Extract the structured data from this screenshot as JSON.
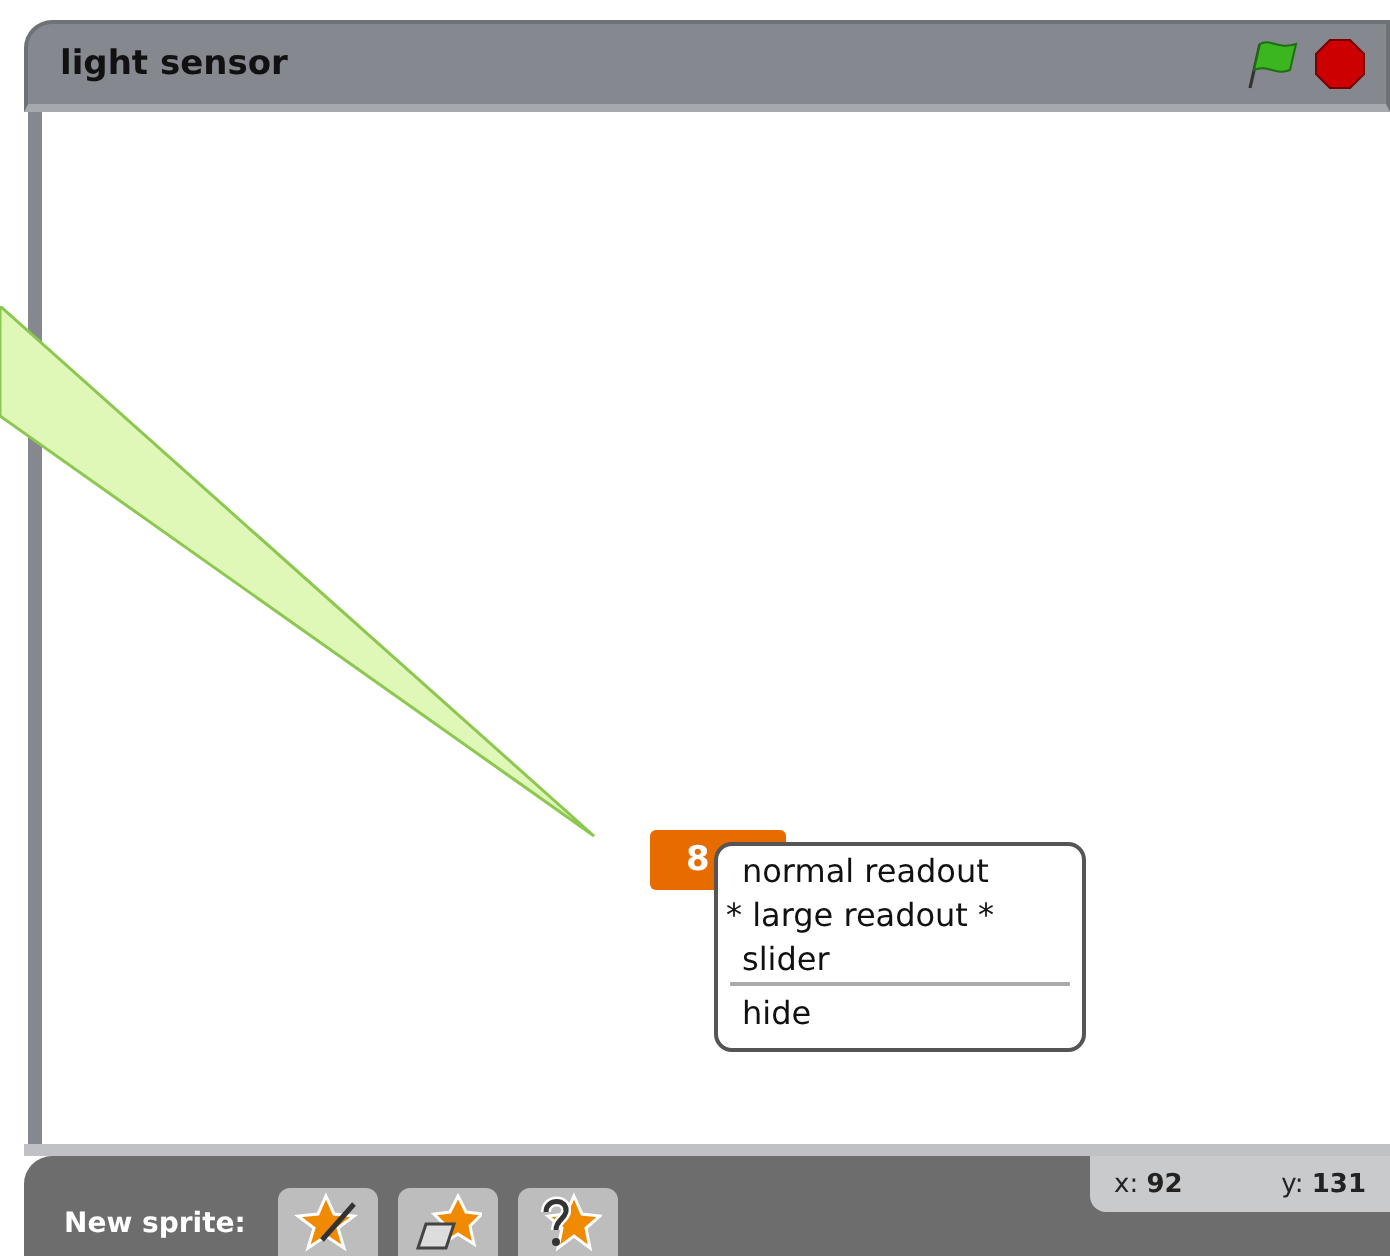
{
  "stage": {
    "title": "light sensor"
  },
  "readout": {
    "value": "8"
  },
  "context_menu": {
    "items": [
      {
        "label": "normal readout",
        "divider_after": false
      },
      {
        "label": "* large readout *",
        "divider_after": false
      },
      {
        "label": "slider",
        "divider_after": true
      },
      {
        "label": "hide",
        "divider_after": false
      }
    ]
  },
  "coordinates": {
    "x": "x: **92**",
    "y": "y: **131**"
  },
  "sprite_bar": {
    "label": "New sprite:",
    "buttons": [
      {
        "kind": "paint"
      },
      {
        "kind": "folder"
      },
      {
        "kind": "surprise"
      }
    ]
  }
}
